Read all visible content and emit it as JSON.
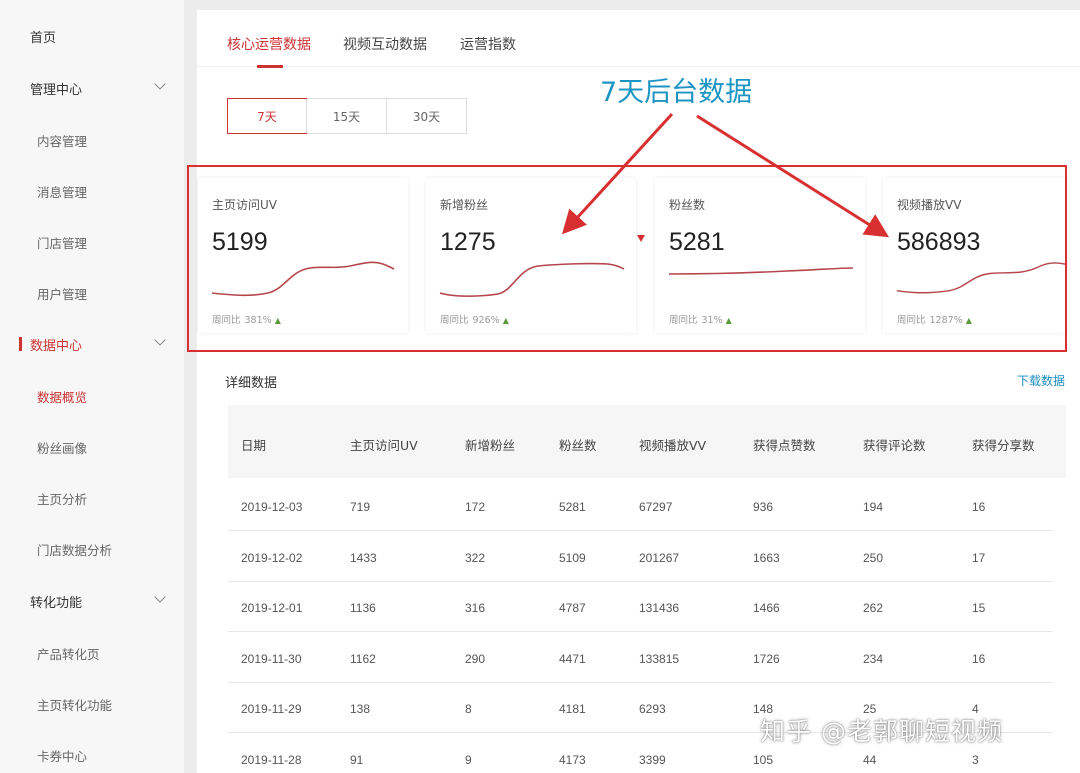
{
  "sidebar": {
    "items": [
      {
        "label": "首页",
        "type": "top"
      },
      {
        "label": "管理中心",
        "type": "top",
        "expandable": true
      },
      {
        "label": "内容管理",
        "type": "sub"
      },
      {
        "label": "消息管理",
        "type": "sub"
      },
      {
        "label": "门店管理",
        "type": "sub"
      },
      {
        "label": "用户管理",
        "type": "sub"
      },
      {
        "label": "数据中心",
        "type": "top",
        "expandable": true,
        "active": true
      },
      {
        "label": "数据概览",
        "type": "sub",
        "active": true
      },
      {
        "label": "粉丝画像",
        "type": "sub"
      },
      {
        "label": "主页分析",
        "type": "sub"
      },
      {
        "label": "门店数据分析",
        "type": "sub"
      },
      {
        "label": "转化功能",
        "type": "top",
        "expandable": true
      },
      {
        "label": "产品转化页",
        "type": "sub"
      },
      {
        "label": "主页转化功能",
        "type": "sub"
      },
      {
        "label": "卡券中心",
        "type": "sub"
      }
    ]
  },
  "tabs": [
    {
      "label": "核心运营数据",
      "active": true
    },
    {
      "label": "视频互动数据"
    },
    {
      "label": "运营指数"
    }
  ],
  "range": {
    "options": [
      "7天",
      "15天",
      "30天"
    ],
    "selected": "7天"
  },
  "annotation": "7天后台数据",
  "cards": [
    {
      "title": "主页访问UV",
      "value": "5199",
      "compare_label": "周同比",
      "compare_value": "381%"
    },
    {
      "title": "新增粉丝",
      "value": "1275",
      "compare_label": "周同比",
      "compare_value": "926%"
    },
    {
      "title": "粉丝数",
      "value": "5281",
      "compare_label": "周同比",
      "compare_value": "31%"
    },
    {
      "title": "视频播放VV",
      "value": "586893",
      "compare_label": "周同比",
      "compare_value": "1287%"
    }
  ],
  "detail": {
    "title": "详细数据",
    "download_label": "下载数据"
  },
  "table": {
    "columns": [
      "日期",
      "主页访问UV",
      "新增粉丝",
      "粉丝数",
      "视频播放VV",
      "获得点赞数",
      "获得评论数",
      "获得分享数"
    ],
    "rows": [
      [
        "2019-12-03",
        "719",
        "172",
        "5281",
        "67297",
        "936",
        "194",
        "16"
      ],
      [
        "2019-12-02",
        "1433",
        "322",
        "5109",
        "201267",
        "1663",
        "250",
        "17"
      ],
      [
        "2019-12-01",
        "1136",
        "316",
        "4787",
        "131436",
        "1466",
        "262",
        "15"
      ],
      [
        "2019-11-30",
        "1162",
        "290",
        "4471",
        "133815",
        "1726",
        "234",
        "16"
      ],
      [
        "2019-11-29",
        "138",
        "8",
        "4181",
        "6293",
        "148",
        "25",
        "4"
      ],
      [
        "2019-11-28",
        "91",
        "9",
        "4173",
        "3399",
        "105",
        "44",
        "3"
      ]
    ]
  },
  "watermark": "知乎 @老郭聊短视频",
  "colors": {
    "accent": "#cc3333",
    "annotation": "#1d95c3",
    "link": "#1d8dc0",
    "up_arrow": "#5c9a3a"
  }
}
